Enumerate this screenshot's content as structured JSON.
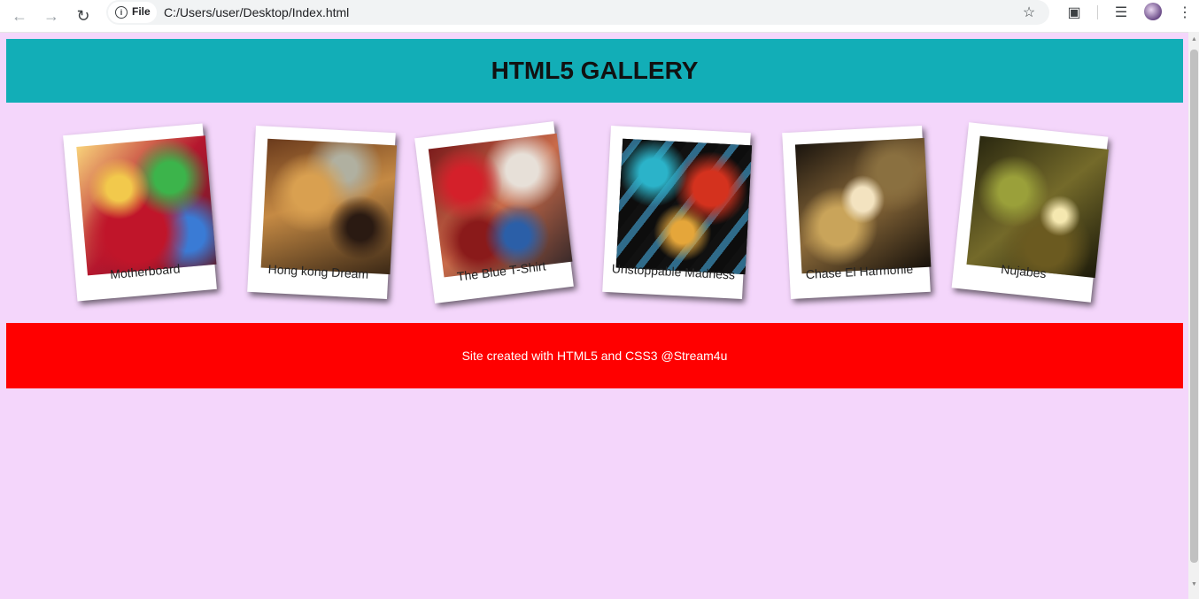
{
  "browser": {
    "site_chip": "File",
    "url": "C:/Users/user/Desktop/Index.html"
  },
  "header": {
    "title": "HTML5 GALLERY",
    "bg_color": "#12aeb7"
  },
  "gallery": [
    {
      "caption": "Motherboard"
    },
    {
      "caption": "Hong kong Dream"
    },
    {
      "caption": "The Blue T-Shirt"
    },
    {
      "caption": "Unstoppable Madness"
    },
    {
      "caption": "Chase El Harmonie"
    },
    {
      "caption": "Nujabes"
    }
  ],
  "footer": {
    "text": "Site created with HTML5 and CSS3 @Stream4u",
    "bg_color": "#ff0000"
  },
  "page_bg_color": "#f4d6fb"
}
